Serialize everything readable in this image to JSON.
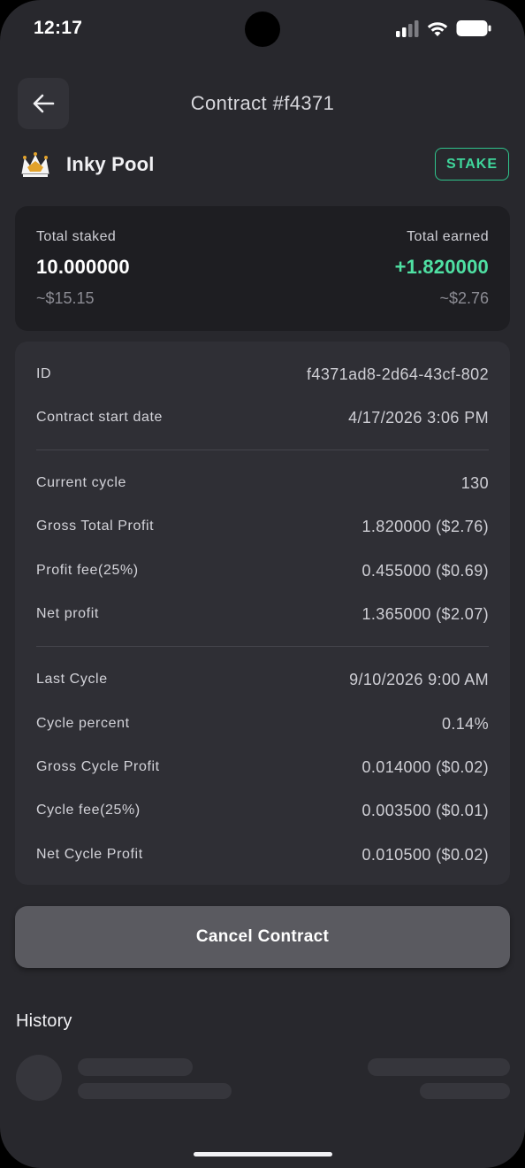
{
  "status_bar": {
    "time": "12:17"
  },
  "header": {
    "title": "Contract #f4371"
  },
  "pool": {
    "name": "Inky Pool",
    "badge": "STAKE"
  },
  "summary": {
    "staked_label": "Total staked",
    "staked_value": "10.000000",
    "staked_usd": "~$15.15",
    "earned_label": "Total earned",
    "earned_value": "+1.820000",
    "earned_usd": "~$2.76",
    "earned_color": "#4fe0a3"
  },
  "details": {
    "id_label": "ID",
    "id_value": "f4371ad8-2d64-43cf-802",
    "start_label": "Contract start date",
    "start_value": "4/17/2026 3:06 PM",
    "cycle_label": "Current cycle",
    "cycle_value": "130",
    "gross_label": "Gross Total Profit",
    "gross_value": "1.820000 ($2.76)",
    "fee_label": "Profit fee(25%)",
    "fee_value": "0.455000 ($0.69)",
    "net_label": "Net profit",
    "net_value": "1.365000 ($2.07)",
    "last_cycle_label": "Last Cycle",
    "last_cycle_value": "9/10/2026 9:00 AM",
    "cycle_pct_label": "Cycle percent",
    "cycle_pct_value": "0.14%",
    "gross_cycle_label": "Gross Cycle Profit",
    "gross_cycle_value": "0.014000 ($0.02)",
    "cycle_fee_label": "Cycle fee(25%)",
    "cycle_fee_value": "0.003500 ($0.01)",
    "net_cycle_label": "Net Cycle Profit",
    "net_cycle_value": "0.010500 ($0.02)"
  },
  "actions": {
    "cancel_label": "Cancel Contract"
  },
  "history": {
    "title": "History"
  },
  "icons": {
    "back": "arrow-left-icon",
    "pool_logo": "crown-logo",
    "signal": "cellular-signal-icon",
    "wifi": "wifi-icon",
    "battery": "battery-icon"
  },
  "colors": {
    "accent_green": "#3fd69b",
    "background": "#28282d"
  }
}
